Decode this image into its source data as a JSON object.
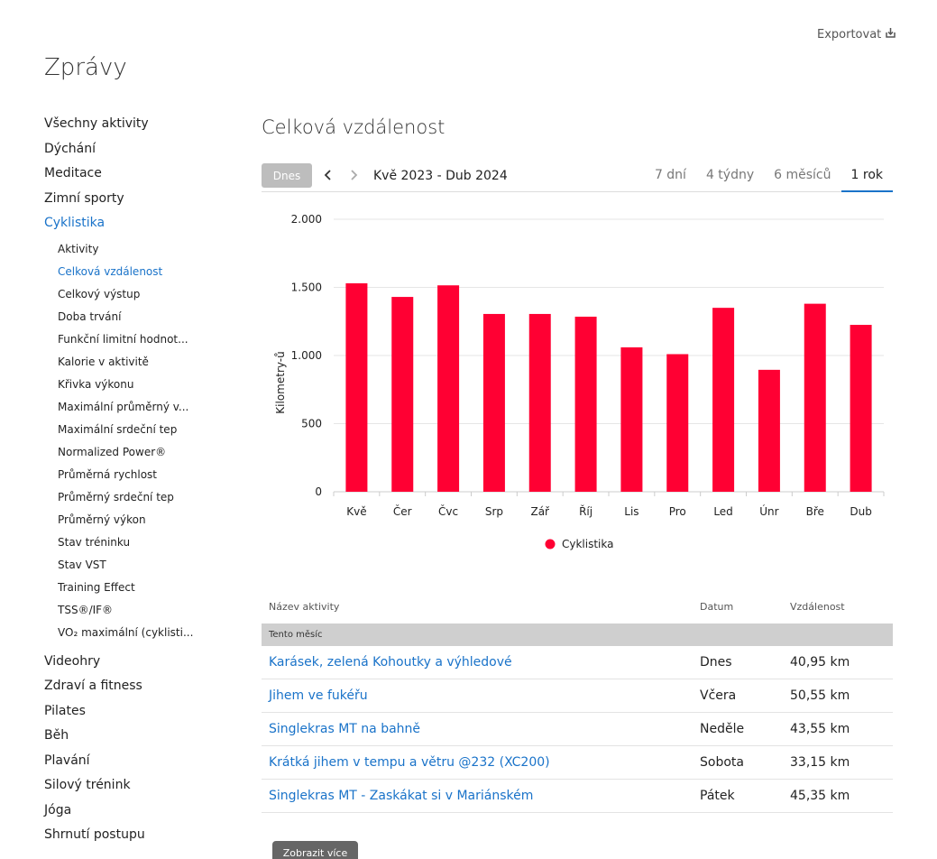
{
  "header": {
    "export_label": "Exportovat",
    "page_title": "Zprávy"
  },
  "sidebar": {
    "top_items": [
      {
        "label": "Všechny aktivity"
      },
      {
        "label": "Dýchání"
      },
      {
        "label": "Meditace"
      },
      {
        "label": "Zimní sporty"
      },
      {
        "label": "Cyklistika",
        "active": true
      }
    ],
    "sub_items": [
      {
        "label": "Aktivity"
      },
      {
        "label": "Celková vzdálenost",
        "active": true
      },
      {
        "label": "Celkový výstup"
      },
      {
        "label": "Doba trvání"
      },
      {
        "label": "Funkční limitní hodnot..."
      },
      {
        "label": "Kalorie v aktivitě"
      },
      {
        "label": "Křivka výkonu"
      },
      {
        "label": "Maximální průměrný v..."
      },
      {
        "label": "Maximální srdeční tep"
      },
      {
        "label": "Normalized Power®"
      },
      {
        "label": "Průměrná rychlost"
      },
      {
        "label": "Průměrný srdeční tep"
      },
      {
        "label": "Průměrný výkon"
      },
      {
        "label": "Stav tréninku"
      },
      {
        "label": "Stav VST"
      },
      {
        "label": "Training Effect"
      },
      {
        "label": "TSS®/IF®"
      },
      {
        "label": "VO₂ maximální (cyklisti..."
      }
    ],
    "bottom_items": [
      {
        "label": "Videohry"
      },
      {
        "label": "Zdraví a fitness"
      },
      {
        "label": "Pilates"
      },
      {
        "label": "Běh"
      },
      {
        "label": "Plavání"
      },
      {
        "label": "Silový trénink"
      },
      {
        "label": "Jóga"
      },
      {
        "label": "Shrnutí postupu"
      }
    ]
  },
  "main": {
    "title": "Celková vzdálenost",
    "today_label": "Dnes",
    "range_label": "Kvě 2023 - Dub 2024",
    "periods": [
      {
        "label": "7 dní"
      },
      {
        "label": "4 týdny"
      },
      {
        "label": "6 měsíců"
      },
      {
        "label": "1 rok",
        "active": true
      }
    ]
  },
  "chart_data": {
    "type": "bar",
    "categories": [
      "Kvě",
      "Čer",
      "Čvc",
      "Srp",
      "Zář",
      "Říj",
      "Lis",
      "Pro",
      "Led",
      "Únr",
      "Bře",
      "Dub"
    ],
    "series": [
      {
        "name": "Cyklistika",
        "values": [
          1530,
          1430,
          1515,
          1305,
          1305,
          1285,
          1060,
          1010,
          1350,
          895,
          1380,
          1225
        ]
      }
    ],
    "ylabel": "Kilometry-ů",
    "ylim": [
      0,
      2000
    ],
    "yticks": [
      0,
      500,
      1000,
      1500,
      2000
    ],
    "ytick_labels": [
      "0",
      "500",
      "1.000",
      "1.500",
      "2.000"
    ],
    "grid": true,
    "legend": "bottom-center",
    "color": "#ff0033"
  },
  "table": {
    "headers": {
      "name": "Název aktivity",
      "date": "Datum",
      "distance": "Vzdálenost"
    },
    "group_label": "Tento měsíc",
    "rows": [
      {
        "name": "Karásek, zelená Kohoutky a výhledové",
        "date": "Dnes",
        "distance": "40,95 km"
      },
      {
        "name": "Jihem ve fukéřu",
        "date": "Včera",
        "distance": "50,55 km"
      },
      {
        "name": "Singlekras MT na bahně",
        "date": "Neděle",
        "distance": "43,55 km"
      },
      {
        "name": "Krátká jihem v tempu a větru @232 (XC200)",
        "date": "Sobota",
        "distance": "33,15 km"
      },
      {
        "name": "Singlekras MT - Zaskákat si v Mariánském",
        "date": "Pátek",
        "distance": "45,35 km"
      }
    ],
    "more_label": "Zobrazit více"
  }
}
